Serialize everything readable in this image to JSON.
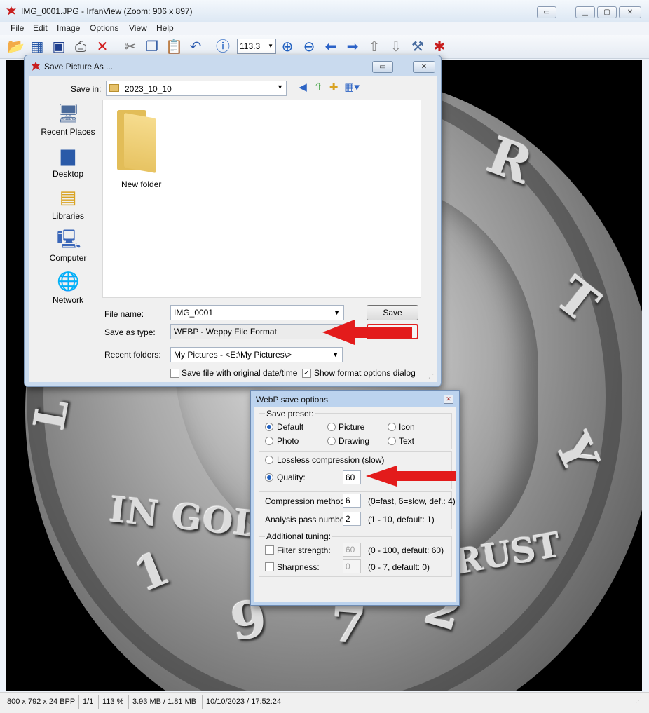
{
  "window": {
    "title": "IMG_0001.JPG - IrfanView (Zoom: 906 x 897)",
    "menu": [
      "File",
      "Edit",
      "Image",
      "Options",
      "View",
      "Help"
    ],
    "zoom_value": "113.3",
    "controls": {
      "minimize": "▁",
      "restore": "▢",
      "close": "✕",
      "extra": "▭"
    }
  },
  "toolbar": {
    "icons": [
      "open-folder-icon",
      "slideshow-icon",
      "save-icon",
      "print-icon",
      "delete-icon",
      "cut-icon",
      "copy-icon",
      "paste-icon",
      "undo-icon",
      "info-icon",
      "zoom-in-icon",
      "zoom-out-icon",
      "previous-icon",
      "next-icon",
      "move-up-icon",
      "move-down-icon",
      "settings-icon",
      "irfanview-icon"
    ]
  },
  "coin": {
    "inscription": "IN GOD",
    "legend_letters": [
      "R",
      "T",
      "Y"
    ],
    "left_letters": [
      "L"
    ],
    "trust": "RUST",
    "year_digits": [
      "1",
      "9",
      "7",
      "2"
    ]
  },
  "status": {
    "dimensions": "800 x 792 x 24 BPP",
    "page": "1/1",
    "zoom": "113 %",
    "size": "3.93 MB / 1.81 MB",
    "datetime": "10/10/2023 / 17:52:24"
  },
  "save_dialog": {
    "title": "Save Picture As ...",
    "save_in_label": "Save in:",
    "save_in_value": "2023_10_10",
    "places": [
      "Recent Places",
      "Desktop",
      "Libraries",
      "Computer",
      "Network"
    ],
    "folder_item": "New folder",
    "file_name_label": "File name:",
    "file_name_value": "IMG_0001",
    "save_button": "Save",
    "save_as_type_label": "Save as type:",
    "save_as_type_value": "WEBP - Weppy File Format",
    "recent_folders_label": "Recent folders:",
    "recent_folders_value": "My Pictures  -  <E:\\My Pictures\\>",
    "checkbox_original_date": "Save file with original date/time",
    "checkbox_show_options": "Show format options dialog",
    "checkbox_original_date_checked": false,
    "checkbox_show_options_checked": true
  },
  "webp_dialog": {
    "title": "WebP save options",
    "close": "✕",
    "preset_label": "Save preset:",
    "presets": [
      "Default",
      "Picture",
      "Icon",
      "Photo",
      "Drawing",
      "Text"
    ],
    "selected_preset": "Default",
    "lossless_label": "Lossless compression (slow)",
    "quality_label": "Quality:",
    "quality_value": "60",
    "compression_label": "Compression method:",
    "compression_value": "6",
    "compression_hint": "(0=fast, 6=slow, def.: 4)",
    "analysis_label": "Analysis pass number:",
    "analysis_value": "2",
    "analysis_hint": "(1 - 10, default: 1)",
    "additional_label": "Additional tuning:",
    "filter_label": "Filter strength:",
    "filter_value": "60",
    "filter_hint": "(0 - 100, default: 60)",
    "sharpness_label": "Sharpness:",
    "sharpness_value": "0",
    "sharpness_hint": "(0 - 7, default: 0)"
  },
  "colors": {
    "arrow": "#e31b1b",
    "title_bar": "#dde8f4",
    "dialog_frame": "#c9daee"
  }
}
